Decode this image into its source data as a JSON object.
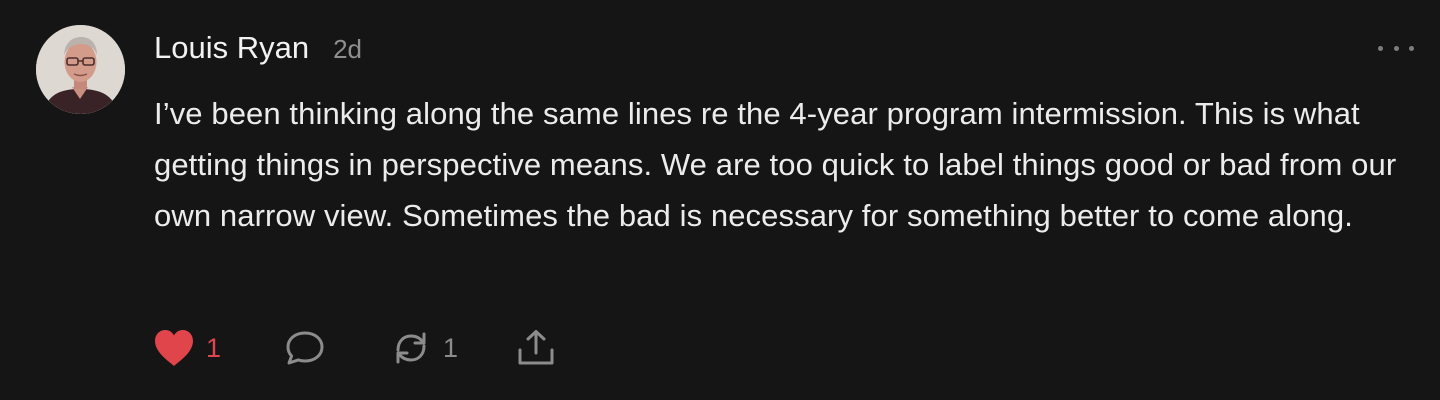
{
  "comment": {
    "author": "Louis Ryan",
    "timestamp": "2d",
    "body": "I’ve been thinking along the same lines re the 4-year program intermission. This is what getting things in perspective means. We are too quick to label things good or bad from our own narrow view. Sometimes the bad is necessary for something better to come along.",
    "icons": {
      "avatar": "avatar",
      "more": "more-horizontal-icon",
      "like": "heart-icon",
      "reply": "speech-bubble-icon",
      "restack": "restack-arrows-icon",
      "share": "share-upload-icon"
    }
  },
  "actions": {
    "likes": "1",
    "restacks": "1"
  },
  "colors": {
    "background": "#151515",
    "text": "#ececec",
    "muted": "#8f8f8f",
    "like": "#e0454b"
  }
}
